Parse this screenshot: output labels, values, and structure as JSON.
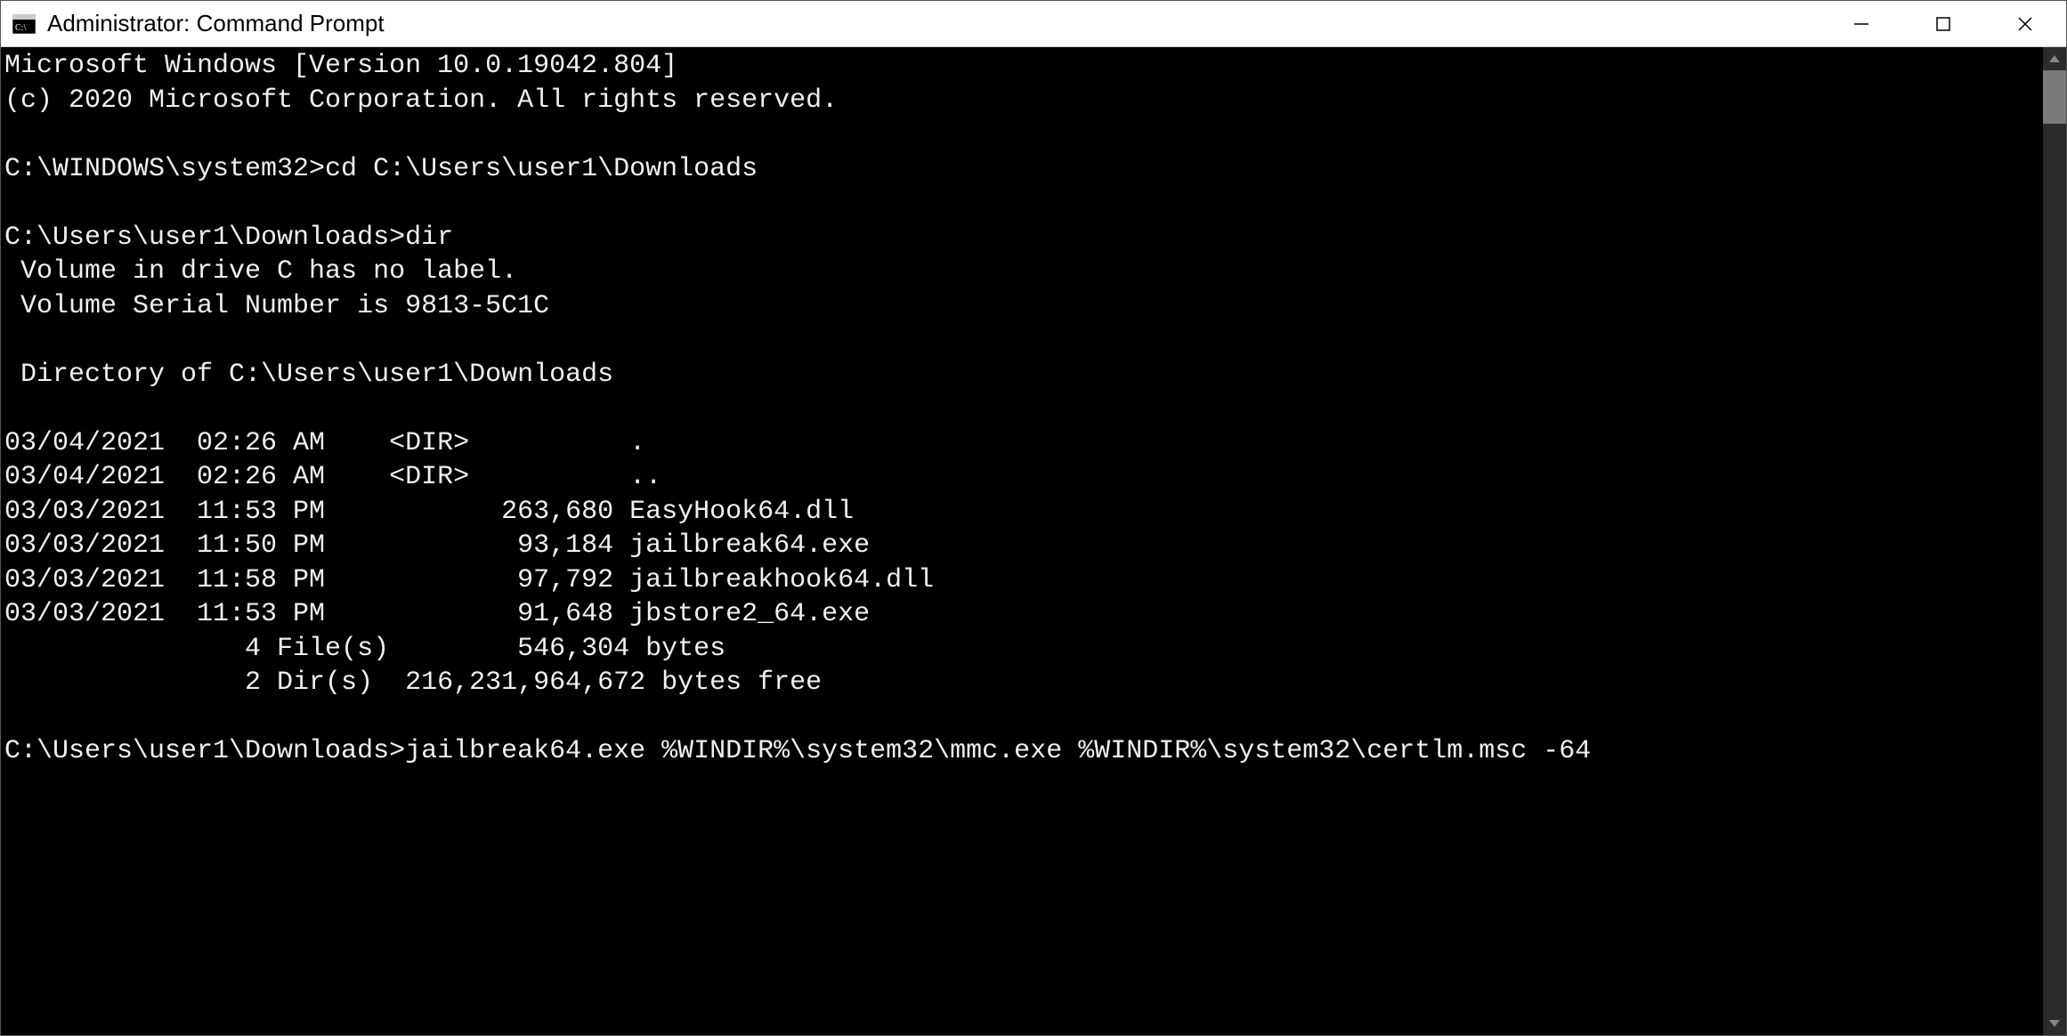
{
  "window": {
    "title": "Administrator: Command Prompt"
  },
  "terminal": {
    "lines": [
      "Microsoft Windows [Version 10.0.19042.804]",
      "(c) 2020 Microsoft Corporation. All rights reserved.",
      "",
      "C:\\WINDOWS\\system32>cd C:\\Users\\user1\\Downloads",
      "",
      "C:\\Users\\user1\\Downloads>dir",
      " Volume in drive C has no label.",
      " Volume Serial Number is 9813-5C1C",
      "",
      " Directory of C:\\Users\\user1\\Downloads",
      "",
      "03/04/2021  02:26 AM    <DIR>          .",
      "03/04/2021  02:26 AM    <DIR>          ..",
      "03/03/2021  11:53 PM           263,680 EasyHook64.dll",
      "03/03/2021  11:50 PM            93,184 jailbreak64.exe",
      "03/03/2021  11:58 PM            97,792 jailbreakhook64.dll",
      "03/03/2021  11:53 PM            91,648 jbstore2_64.exe",
      "               4 File(s)        546,304 bytes",
      "               2 Dir(s)  216,231,964,672 bytes free",
      "",
      "C:\\Users\\user1\\Downloads>jailbreak64.exe %WINDIR%\\system32\\mmc.exe %WINDIR%\\system32\\certlm.msc -64"
    ]
  }
}
